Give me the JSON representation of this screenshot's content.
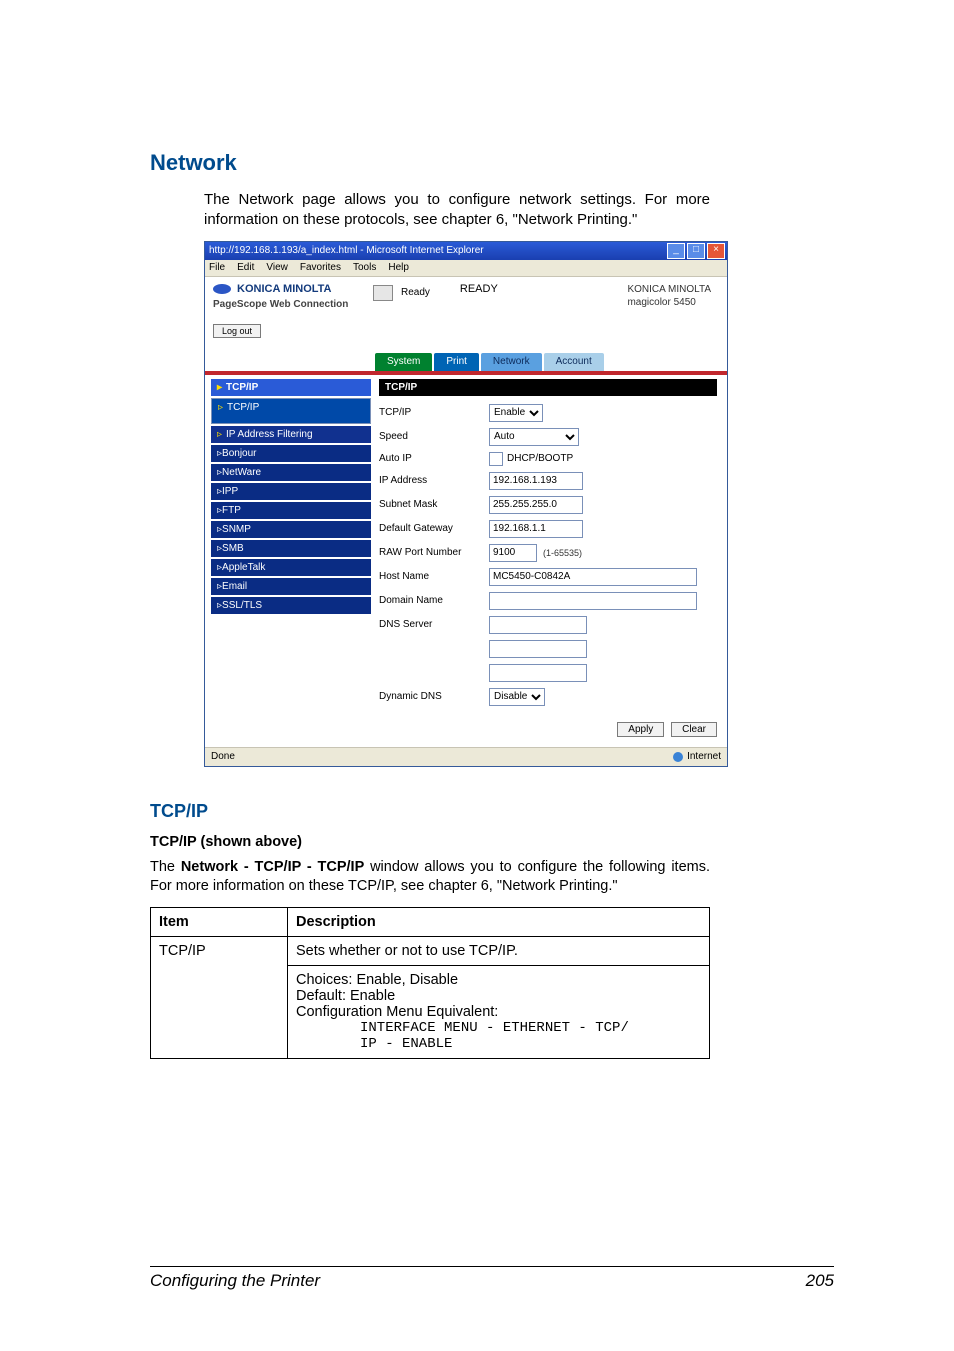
{
  "section_heading": "Network",
  "intro_text": "The Network page allows you to configure network settings. For more information on these protocols, see chapter 6, \"Network Printing.\"",
  "ie": {
    "title": "http://192.168.1.193/a_index.html - Microsoft Internet Explorer",
    "menu": {
      "file": "File",
      "edit": "Edit",
      "view": "View",
      "favorites": "Favorites",
      "tools": "Tools",
      "help": "Help"
    },
    "status_done": "Done",
    "zone": "Internet"
  },
  "header": {
    "brand": "KONICA MINOLTA",
    "pagescope": "PageScope Web Connection",
    "logout": "Log out",
    "ready_label": "Ready",
    "ready_big": "READY",
    "company": "KONICA MINOLTA",
    "model": "magicolor 5450"
  },
  "tabs": {
    "system": "System",
    "print": "Print",
    "network": "Network",
    "account": "Account"
  },
  "sidebar": {
    "top": "TCP/IP",
    "items": [
      "TCP/IP",
      "IP Address Filtering",
      "Bonjour",
      "NetWare",
      "IPP",
      "FTP",
      "SNMP",
      "SMB",
      "AppleTalk",
      "Email",
      "SSL/TLS"
    ]
  },
  "form": {
    "title": "TCP/IP",
    "rows": {
      "tcpip": {
        "label": "TCP/IP",
        "value": "Enable"
      },
      "speed": {
        "label": "Speed",
        "value": "Auto"
      },
      "autoip": {
        "label": "Auto IP",
        "value": "DHCP/BOOTP"
      },
      "ipaddr": {
        "label": "IP Address",
        "value": "192.168.1.193"
      },
      "subnet": {
        "label": "Subnet Mask",
        "value": "255.255.255.0"
      },
      "gateway": {
        "label": "Default Gateway",
        "value": "192.168.1.1"
      },
      "rawport": {
        "label": "RAW Port Number",
        "value": "9100",
        "range": "(1-65535)"
      },
      "hostname": {
        "label": "Host Name",
        "value": "MC5450-C0842A"
      },
      "domain": {
        "label": "Domain Name",
        "value": ""
      },
      "dnssrv": {
        "label": "DNS Server"
      },
      "dyndns": {
        "label": "Dynamic DNS",
        "value": "Disable"
      }
    },
    "buttons": {
      "apply": "Apply",
      "clear": "Clear"
    }
  },
  "tcpip": {
    "heading": "TCP/IP",
    "shown_above": "TCP/IP (shown above)",
    "desc1": "The ",
    "desc_bold": "Network - TCP/IP - TCP/IP",
    "desc2": " window allows you to configure the following items. For more information on these TCP/IP, see chapter 6, \"Network Printing.\""
  },
  "table": {
    "h_item": "Item",
    "h_desc": "Description",
    "row1_item": "TCP/IP",
    "row1_line1": "Sets whether or not to use TCP/IP.",
    "row1_line2": "Choices: Enable, Disable",
    "row1_line3": "Default:  Enable",
    "row1_line4": "Configuration Menu Equivalent:",
    "row1_line5": "INTERFACE MENU - ETHERNET - TCP/",
    "row1_line6": "IP - ENABLE"
  },
  "footer": {
    "left": "Configuring the Printer",
    "right": "205"
  }
}
